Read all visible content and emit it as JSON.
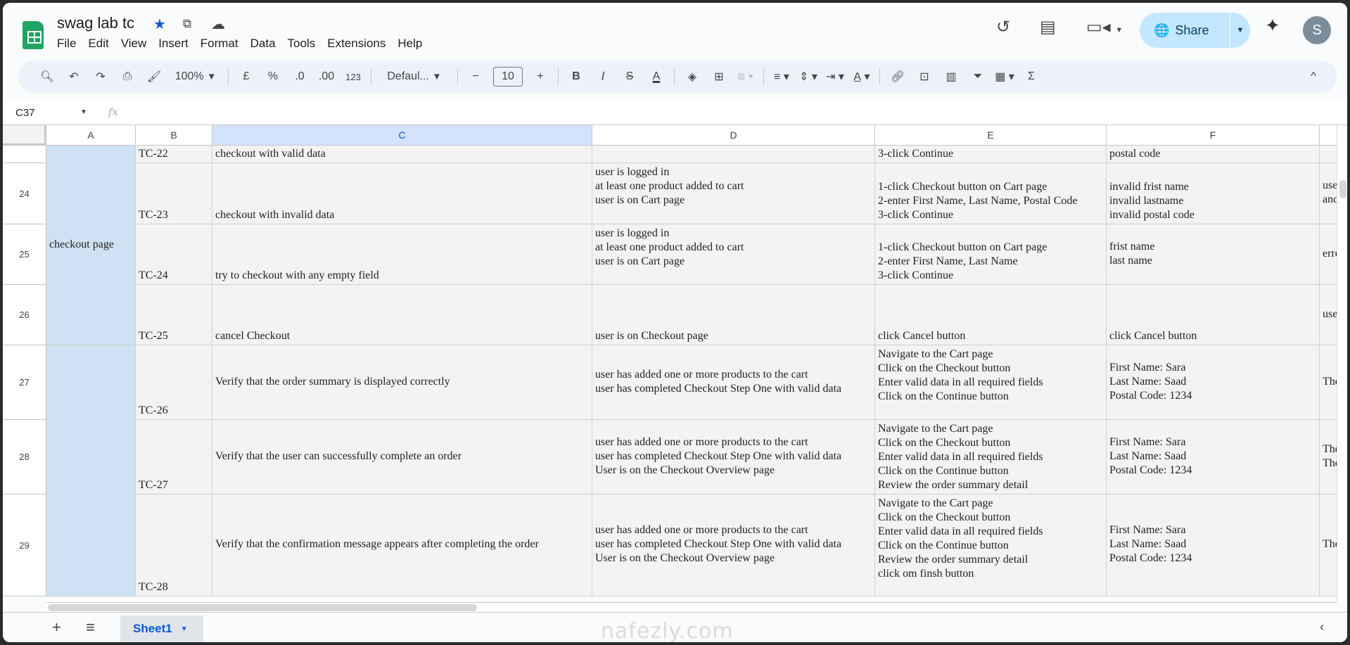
{
  "app": {
    "title": "swag lab tc",
    "user_initial": "S",
    "share_label": "Share"
  },
  "menu": [
    "File",
    "Edit",
    "View",
    "Insert",
    "Format",
    "Data",
    "Tools",
    "Extensions",
    "Help"
  ],
  "toolbar": {
    "zoom": "100%",
    "currency": "£",
    "percent": "%",
    "dec_dec": ".0",
    "dec_inc": ".00",
    "number_format": "123",
    "font": "Defaul...",
    "font_size": "10",
    "bold": "B",
    "italic": "I",
    "text_color": "A"
  },
  "formula_bar": {
    "cell_ref": "C37",
    "fx": "fx",
    "value": ""
  },
  "columns": [
    "A",
    "B",
    "C",
    "D",
    "E",
    "F"
  ],
  "rows": [
    {
      "num": "",
      "b": "TC-22",
      "c": "checkout with valid data",
      "d": "",
      "e": "3-click Continue",
      "f": "postal code",
      "g": ""
    },
    {
      "num": "24",
      "b": "TC-23",
      "c": "checkout with invalid data",
      "d": "user is logged in\nat least one product added to cart\nuser is on Cart page",
      "e": "1-click Checkout button on Cart page\n2-enter First Name, Last Name, Postal Code\n3-click Continue",
      "f": "invalid frist name\ninvalid lastname\ninvalid postal code",
      "g": "use\nand"
    },
    {
      "num": "25",
      "b": "TC-24",
      "c": "try to checkout with any empty field",
      "d": "user is logged in\nat least one product added to cart\nuser is on Cart page",
      "e": "1-click Checkout button on Cart page\n2-enter First Name, Last Name\n3-click Continue",
      "f": "frist name\nlast name",
      "g": "erro"
    },
    {
      "num": "26",
      "b": "TC-25",
      "c": "cancel Checkout",
      "d": "user is on Checkout page",
      "e": "click Cancel button",
      "f": "click Cancel button",
      "g": "use"
    },
    {
      "num": "27",
      "b": "TC-26",
      "c": "Verify that the order summary is displayed correctly",
      "d": "user has added one or more products to the cart\nuser has completed Checkout Step One with valid data",
      "e": "Navigate to the Cart page\nClick on the Checkout button\nEnter valid data in all required fields\nClick on the Continue button",
      "f": "First Name: Sara\nLast Name: Saad\nPostal Code: 1234",
      "g": "The"
    },
    {
      "num": "28",
      "b": "TC-27",
      "c": "Verify that the user can successfully complete an order",
      "d": "user has added one or more products to the cart\nuser has completed Checkout Step One with valid data\nUser is on the Checkout Overview page",
      "e": "Navigate to the Cart page\nClick on the Checkout button\nEnter valid data in all required fields\nClick on the Continue button\nReview the order summary detail",
      "f": "First Name: Sara\nLast Name: Saad\nPostal Code: 1234",
      "g": "The\nThe"
    },
    {
      "num": "29",
      "b": "TC-28",
      "c": "Verify that the confirmation message appears after completing the order",
      "d": "user has added one or more products to the cart\nuser has completed Checkout Step One with valid data\nUser is on the Checkout Overview page",
      "e": "Navigate to the Cart page\nClick on the Checkout button\nEnter valid data in all required fields\nClick on the Continue button\nReview the order summary detail\nclick om finsh button",
      "f": "First Name: Sara\nLast Name: Saad\nPostal Code: 1234",
      "g": "The"
    }
  ],
  "groups": {
    "checkout": "checkout page",
    "summary": ""
  },
  "sheets": [
    {
      "name": "Sheet1"
    }
  ],
  "watermark": "nafezly.com"
}
